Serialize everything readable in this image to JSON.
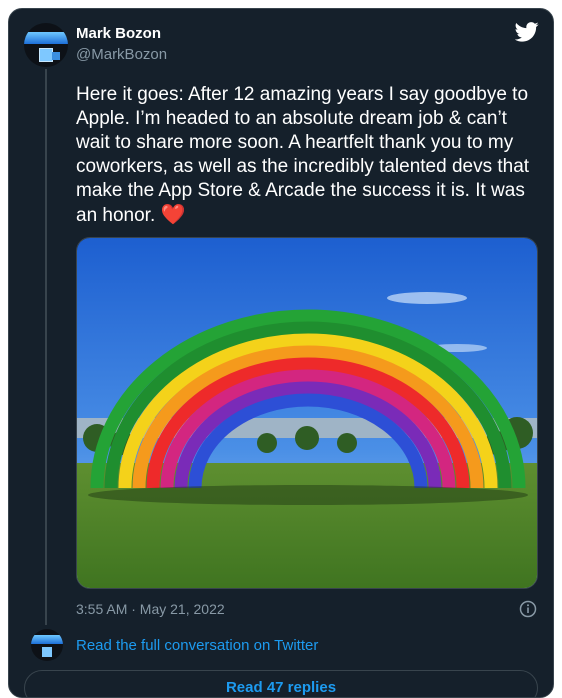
{
  "author": {
    "name": "Mark Bozon",
    "handle": "@MarkBozon"
  },
  "tweet": {
    "text": "Here it goes: After 12 amazing years I say goodbye to Apple. I’m headed to an absolute dream job & can’t wait to share more soon. A heartfelt thank you to my coworkers, as well as the incredibly talented devs that make the App Store & Arcade the success it is. It was an honor. ",
    "emoji": "❤️",
    "timestamp": "3:55 AM · May 21, 2022"
  },
  "footer": {
    "conversation_link": "Read the full conversation on Twitter",
    "replies_button": "Read 47 replies"
  },
  "icons": {
    "brand": "twitter-bird-icon",
    "info": "info-icon"
  },
  "colors": {
    "background": "#15202b",
    "text": "#ffffff",
    "secondary": "#8899a6",
    "link": "#1d9bf0",
    "border": "#38444d"
  }
}
